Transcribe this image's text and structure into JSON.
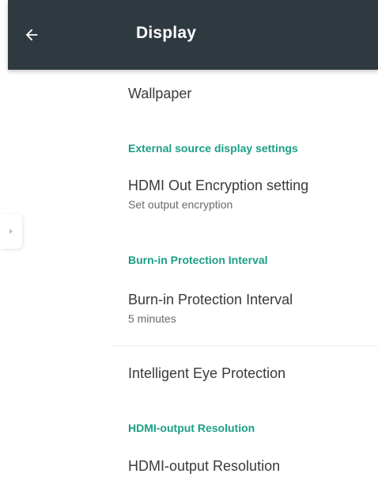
{
  "appbar": {
    "title": "Display",
    "back_icon": "arrow-back-icon"
  },
  "side_handle": {
    "icon": "chevron-right-icon"
  },
  "items": {
    "wallpaper": {
      "title": "Wallpaper"
    },
    "hdmi_encryption": {
      "title": "HDMI Out Encryption setting",
      "summary": "Set output encryption"
    },
    "burn_in": {
      "title": "Burn-in Protection Interval",
      "summary": "5 minutes"
    },
    "eye_protection": {
      "title": "Intelligent Eye Protection"
    },
    "hdmi_resolution": {
      "title": "HDMI-output Resolution"
    }
  },
  "sections": {
    "external_source": "External source display settings",
    "burn_in": "Burn-in Protection Interval",
    "hdmi_resolution": "HDMI-output Resolution"
  },
  "colors": {
    "appbar_bg": "#2f3a40",
    "accent": "#1b9e86",
    "text_primary": "#3a3a3a",
    "text_secondary": "#6a6a6a"
  }
}
